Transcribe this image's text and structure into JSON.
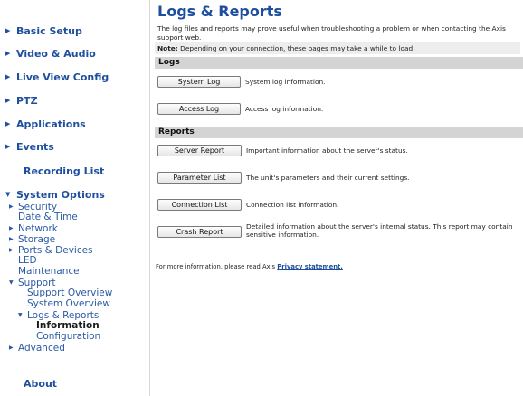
{
  "sidebar": {
    "basic_setup": "Basic Setup",
    "video_audio": "Video & Audio",
    "live_view_config": "Live View Config",
    "ptz": "PTZ",
    "applications": "Applications",
    "events": "Events",
    "recording_list": "Recording List",
    "system_options": "System Options",
    "security": "Security",
    "date_time": "Date & Time",
    "network": "Network",
    "storage": "Storage",
    "ports_devices": "Ports & Devices",
    "led": "LED",
    "maintenance": "Maintenance",
    "support": "Support",
    "support_overview": "Support Overview",
    "system_overview": "System Overview",
    "logs_reports": "Logs & Reports",
    "information": "Information",
    "configuration": "Configuration",
    "advanced": "Advanced",
    "about": "About"
  },
  "main": {
    "title": "Logs & Reports",
    "intro": "The log files and reports may prove useful when troubleshooting a problem or when contacting the Axis support web.",
    "note_label": "Note:",
    "note_text": "Depending on your connection, these pages may take a while to load.",
    "logs_header": "Logs",
    "system_log_button": "System Log",
    "system_log_desc": "System log information.",
    "access_log_button": "Access Log",
    "access_log_desc": "Access log information.",
    "reports_header": "Reports",
    "server_report_button": "Server Report",
    "server_report_desc": "Important information about the server's status.",
    "parameter_list_button": "Parameter List",
    "parameter_list_desc": "The unit's parameters and their current settings.",
    "connection_list_button": "Connection List",
    "connection_list_desc": "Connection list information.",
    "crash_report_button": "Crash Report",
    "crash_report_desc": "Detailed information about the server's internal status. This report may contain sensitive information.",
    "footer_text": "For more information, please read Axis",
    "footer_link": "Privacy statement."
  },
  "colors": {
    "link": "#1e4f9e",
    "section_bar": "#d4d4d4",
    "note_bg": "#ededed"
  }
}
